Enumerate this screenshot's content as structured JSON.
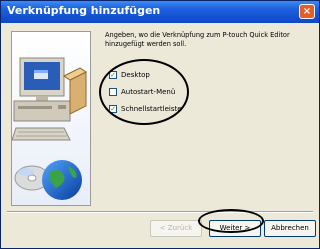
{
  "window": {
    "title": "Verknüpfung hinzufügen",
    "close_glyph": "×"
  },
  "instruction": "Angeben, wo die Verknüpfung zum P-touch Quick Editor hinzugefügt werden soll.",
  "options": [
    {
      "label": "Desktop",
      "checked": true
    },
    {
      "label": "Autostart-Menü",
      "checked": false
    },
    {
      "label": "Schnellstartleiste",
      "checked": true
    }
  ],
  "buttons": {
    "back": "< Zurück",
    "next": "Weiter >",
    "cancel": "Abbrechen"
  },
  "colors": {
    "title_bar": "#1452d3",
    "check_mark": "#21a121",
    "annotation": "#000000"
  },
  "icons": [
    "computer-icon",
    "cd-disc-icon",
    "globe-icon",
    "check-icon",
    "close-icon"
  ]
}
